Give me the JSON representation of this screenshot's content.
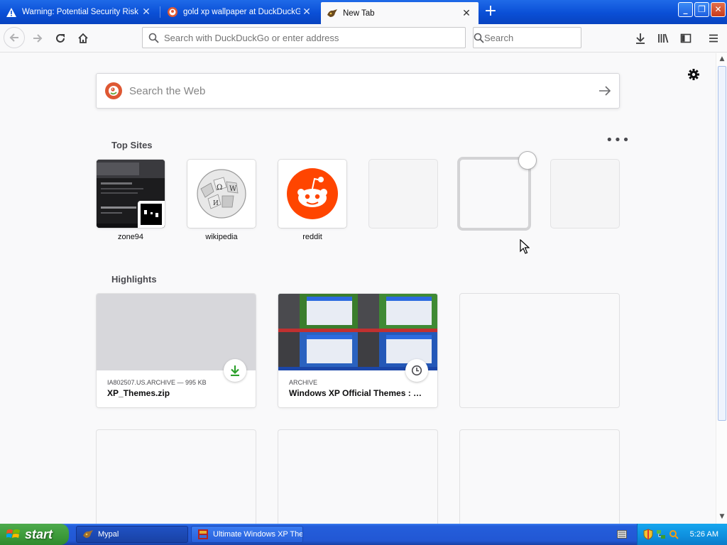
{
  "tabs": [
    {
      "title": "Warning: Potential Security Risk Ahead",
      "icon": "warning-icon",
      "active": false
    },
    {
      "title": "gold xp wallpaper at DuckDuckGo",
      "icon": "duckduckgo-icon",
      "active": false
    },
    {
      "title": "New Tab",
      "icon": "new-tab-icon",
      "active": true
    }
  ],
  "window_buttons": {
    "minimize": "_",
    "maximize": "❐",
    "close": "✕"
  },
  "toolbar": {
    "url_placeholder": "Search with DuckDuckGo or enter address",
    "search_placeholder": "Search"
  },
  "newtab": {
    "web_search_placeholder": "Search the Web",
    "top_sites_title": "Top Sites",
    "highlights_title": "Highlights",
    "top_sites": [
      {
        "label": "zone94"
      },
      {
        "label": "wikipedia"
      },
      {
        "label": "reddit"
      }
    ],
    "highlights": [
      {
        "context": "IA802507.US.ARCHIVE — 995 KB",
        "title": "XP_Themes.zip",
        "badge": "download-icon"
      },
      {
        "context": "ARCHIVE",
        "title": "Windows XP Official Themes : Microsoft : Free Download, Borrow, and Streaming : Internet Archive",
        "badge": "clock-icon"
      }
    ]
  },
  "taskbar": {
    "start_label": "start",
    "buttons": [
      {
        "label": "Mypal",
        "active": true
      },
      {
        "label": "Ultimate Windows XP Themes",
        "active": false
      }
    ],
    "clock": "5:26 AM"
  },
  "colors": {
    "xp_blue": "#245edb",
    "start_green": "#3c9a3a",
    "ddg_orange": "#de5833",
    "reddit_orange": "#ff4500",
    "download_green": "#2ca02c"
  }
}
